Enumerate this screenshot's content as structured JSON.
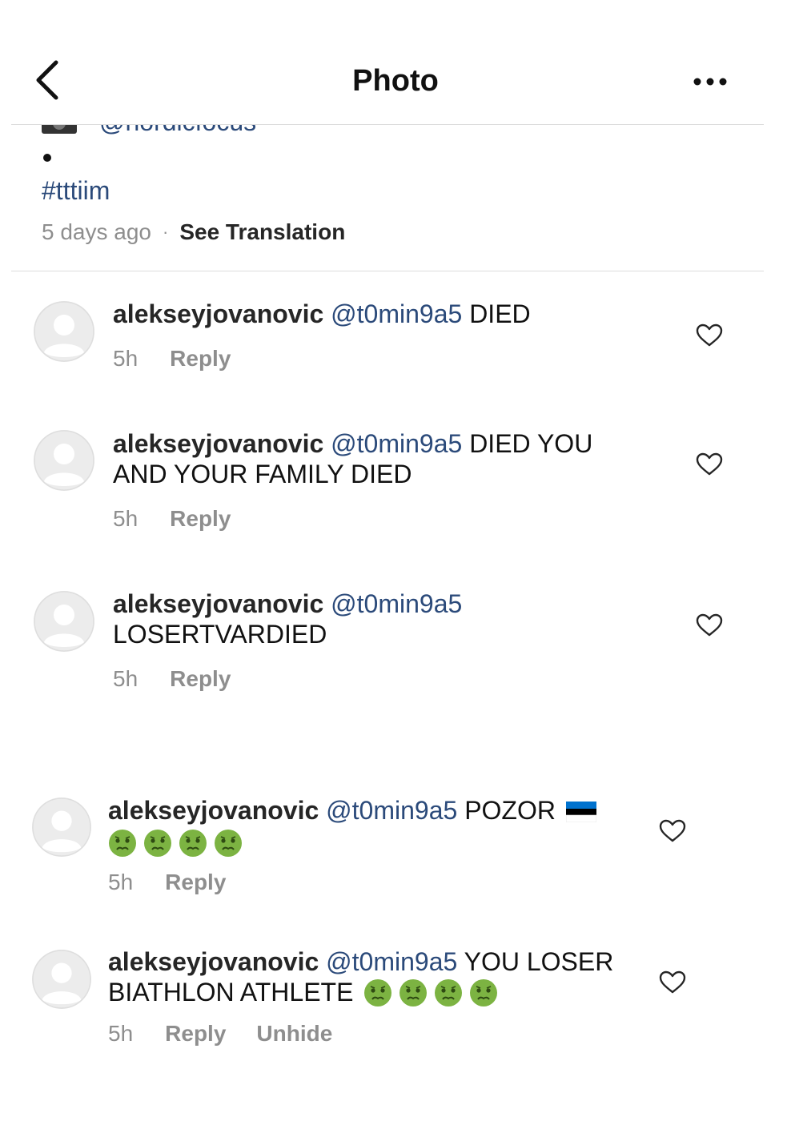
{
  "header": {
    "title": "Photo"
  },
  "post": {
    "caption_mention": "@nordicfocus",
    "hashtag": "#tttiim",
    "time": "5 days ago",
    "separator": "·",
    "see_translation": "See Translation"
  },
  "comments": [
    {
      "username": "alekseyjovanovic",
      "mention": "@t0min9a5",
      "text": "DIED",
      "text2": "",
      "age": "5h",
      "reply": "Reply"
    },
    {
      "username": "alekseyjovanovic",
      "mention": "@t0min9a5",
      "text": "DIED YOU",
      "text2": "AND YOUR FAMILY DIED",
      "age": "5h",
      "reply": "Reply"
    },
    {
      "username": "alekseyjovanovic",
      "mention": "@t0min9a5",
      "text": "",
      "text2": "LOSERTVARDIED",
      "age": "5h",
      "reply": "Reply"
    },
    {
      "username": "alekseyjovanovic",
      "mention": "@t0min9a5",
      "text": "POZOR",
      "text2": "",
      "age": "5h",
      "reply": "Reply",
      "flag": "estonian-flag",
      "emoji_count": 4
    },
    {
      "username": "alekseyjovanovic",
      "mention": "@t0min9a5",
      "text": "YOU LOSER",
      "text2": "BIATHLON ATHLETE",
      "age": "5h",
      "reply": "Reply",
      "unhide": "Unhide",
      "emoji_count": 4
    }
  ],
  "icons": {
    "back": "chevron-left-icon",
    "more": "more-horizontal-icon",
    "like": "heart-outline-icon",
    "avatar": "default-avatar-icon",
    "emoji": "nauseated-face-emoji"
  },
  "colors": {
    "mention": "#2b4a7a",
    "muted": "#8e8e8e",
    "divider": "#dddddd",
    "flag_blue": "#0072CE",
    "flag_black": "#000000",
    "flag_white": "#FFFFFF"
  }
}
